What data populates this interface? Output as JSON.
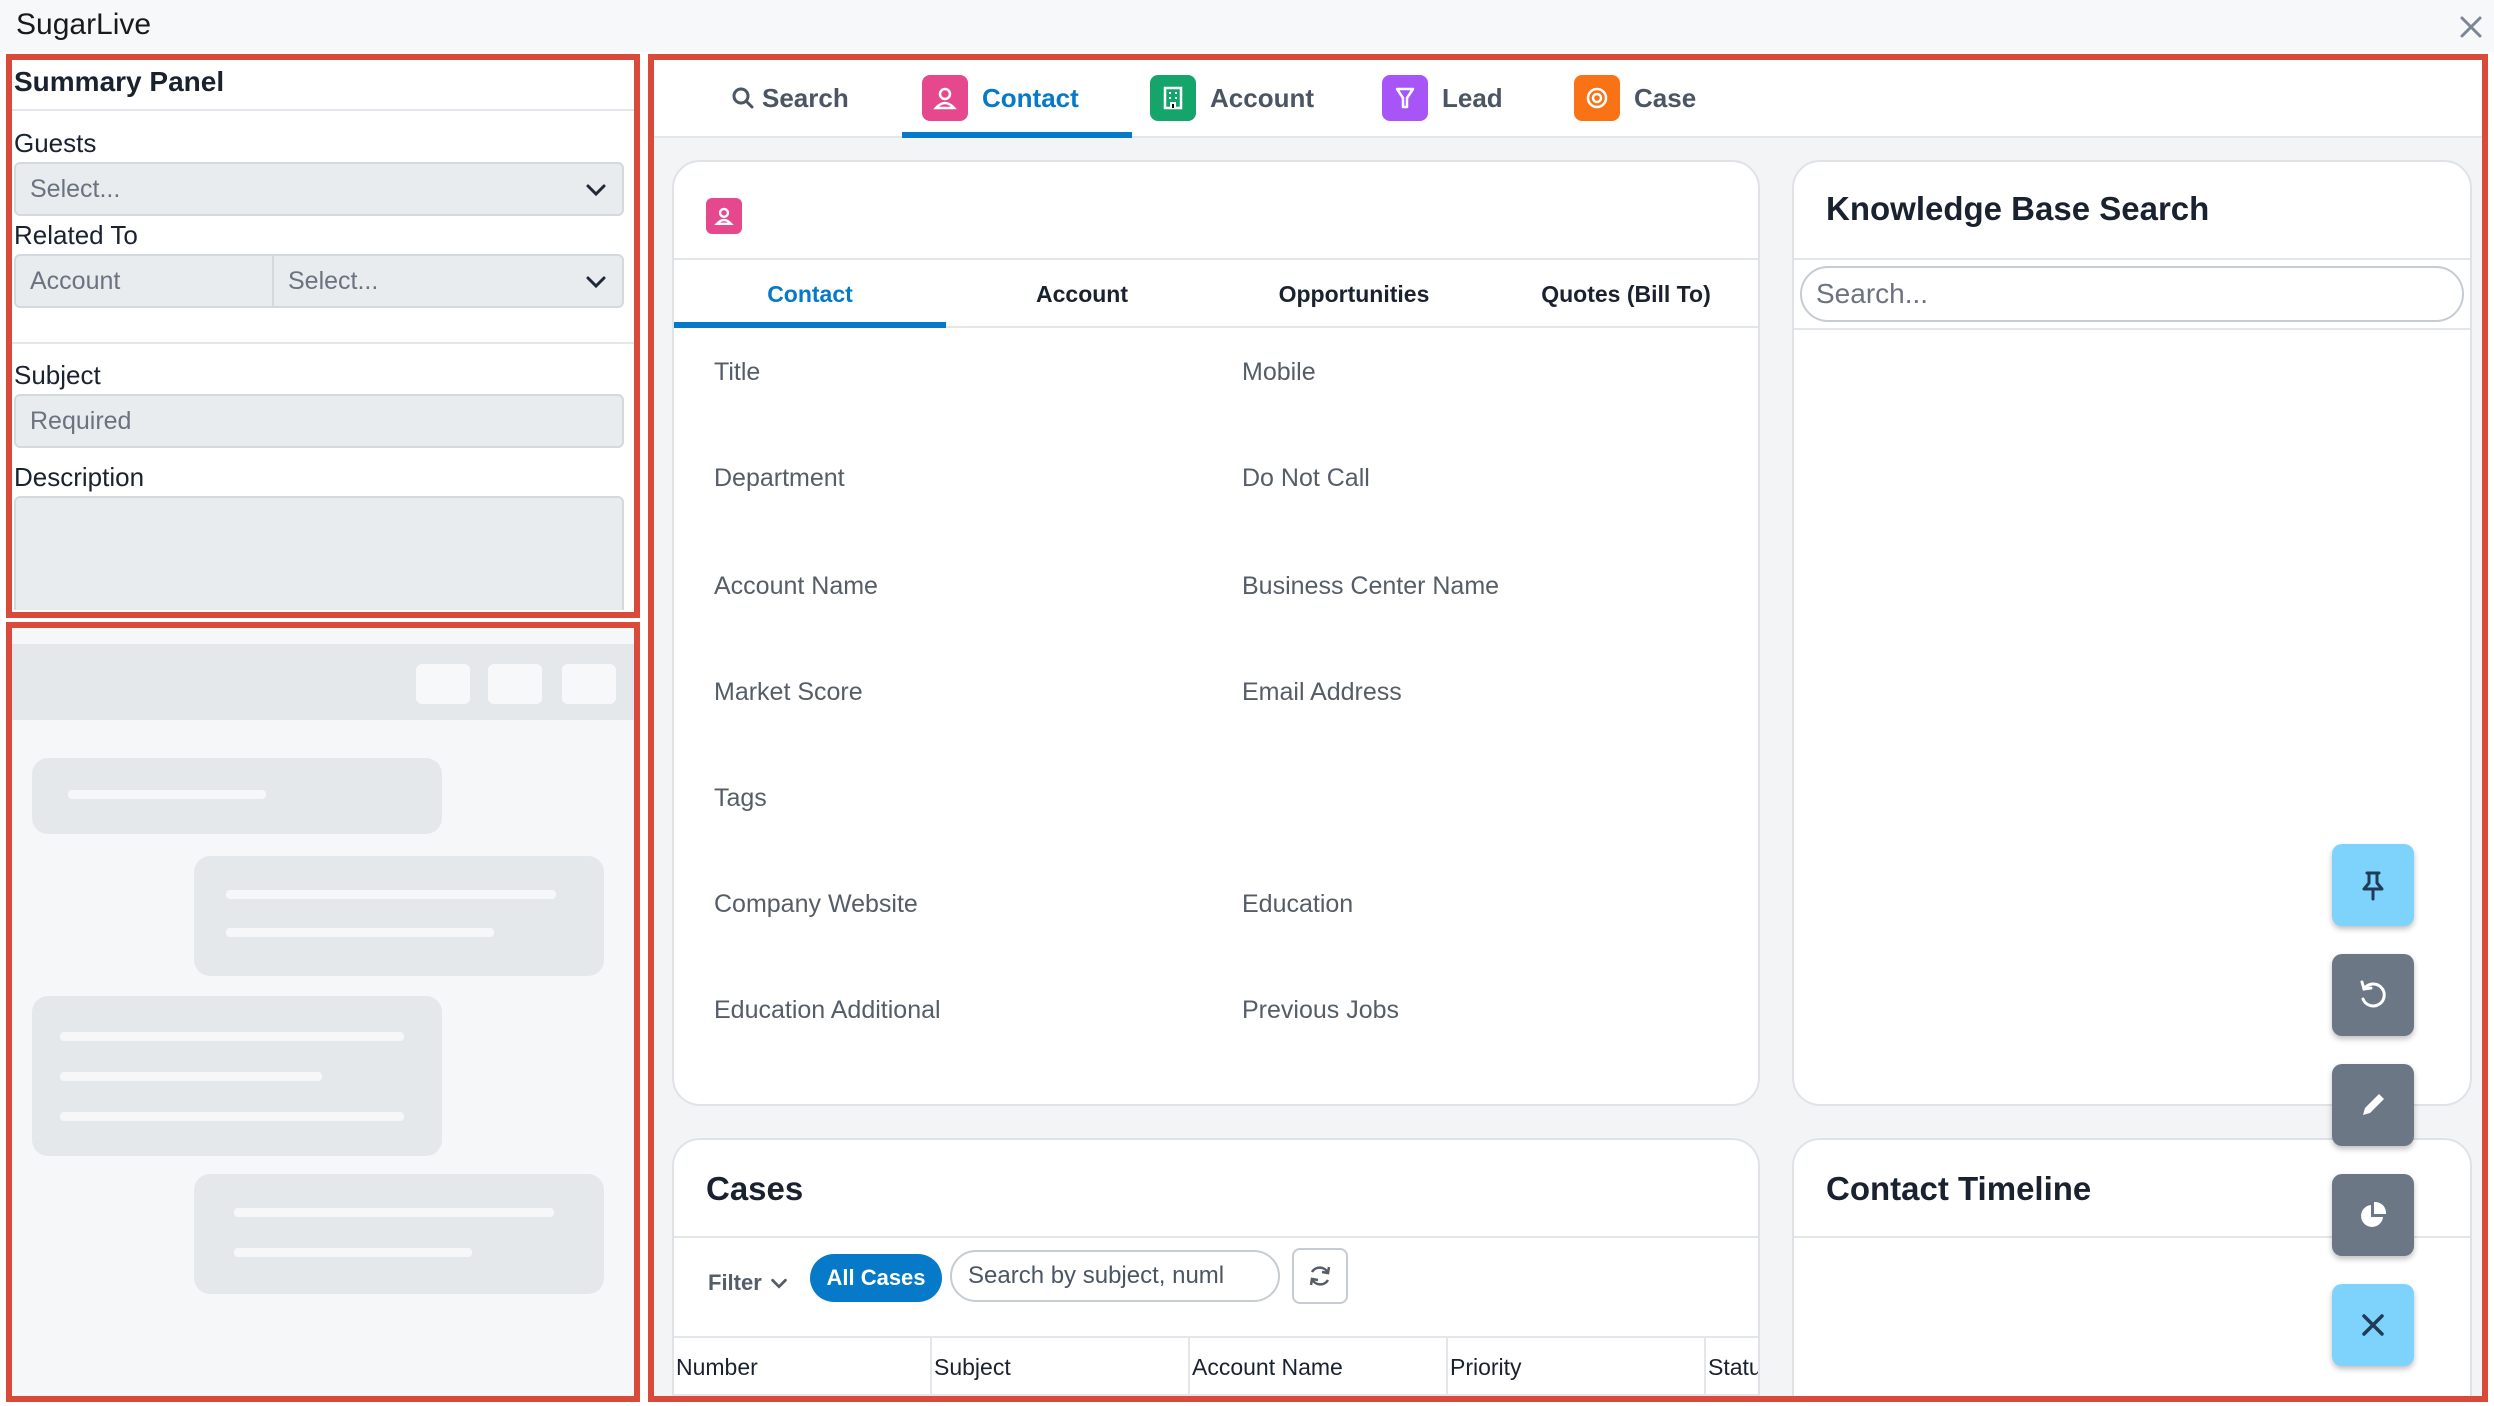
{
  "window": {
    "title": "SugarLive"
  },
  "summary": {
    "title": "Summary Panel",
    "guests_label": "Guests",
    "guests_placeholder": "Select...",
    "related_label": "Related To",
    "related_module": "Account",
    "related_placeholder": "Select...",
    "subject_label": "Subject",
    "subject_placeholder": "Required",
    "description_label": "Description"
  },
  "tabs": [
    {
      "label": "Search",
      "icon": "search-icon"
    },
    {
      "label": "Contact",
      "icon": "contact-icon",
      "color": "#e6488d"
    },
    {
      "label": "Account",
      "icon": "building-icon",
      "color": "#15a56b"
    },
    {
      "label": "Lead",
      "icon": "lead-icon",
      "color": "#a855f7"
    },
    {
      "label": "Case",
      "icon": "lifebuoy-icon",
      "color": "#f97316"
    }
  ],
  "contact": {
    "subtabs": [
      "Contact",
      "Account",
      "Opportunities",
      "Quotes (Bill To)"
    ],
    "fields_left": [
      "Title",
      "Department",
      "Account Name",
      "Market Score",
      "Tags",
      "Company Website",
      "Education Additional"
    ],
    "fields_right": [
      "Mobile",
      "Do Not Call",
      "Business Center Name",
      "Email Address",
      "",
      "Education",
      "Previous Jobs"
    ]
  },
  "kb": {
    "title": "Knowledge Base Search",
    "search_placeholder": "Search..."
  },
  "cases": {
    "title": "Cases",
    "filter_label": "Filter",
    "all_label": "All Cases",
    "search_placeholder": "Search by subject, numl",
    "columns": [
      "Number",
      "Subject",
      "Account Name",
      "Priority",
      "Status"
    ]
  },
  "timeline": {
    "title": "Contact Timeline"
  },
  "fabs": [
    "pin-icon",
    "undo-icon",
    "pencil-icon",
    "pie-chart-icon",
    "close-icon"
  ],
  "colors": {
    "accent": "#0679c8",
    "annotation": "#d94a3a",
    "fab_light": "#7dd3fc",
    "fab_dark": "#6b7785"
  }
}
